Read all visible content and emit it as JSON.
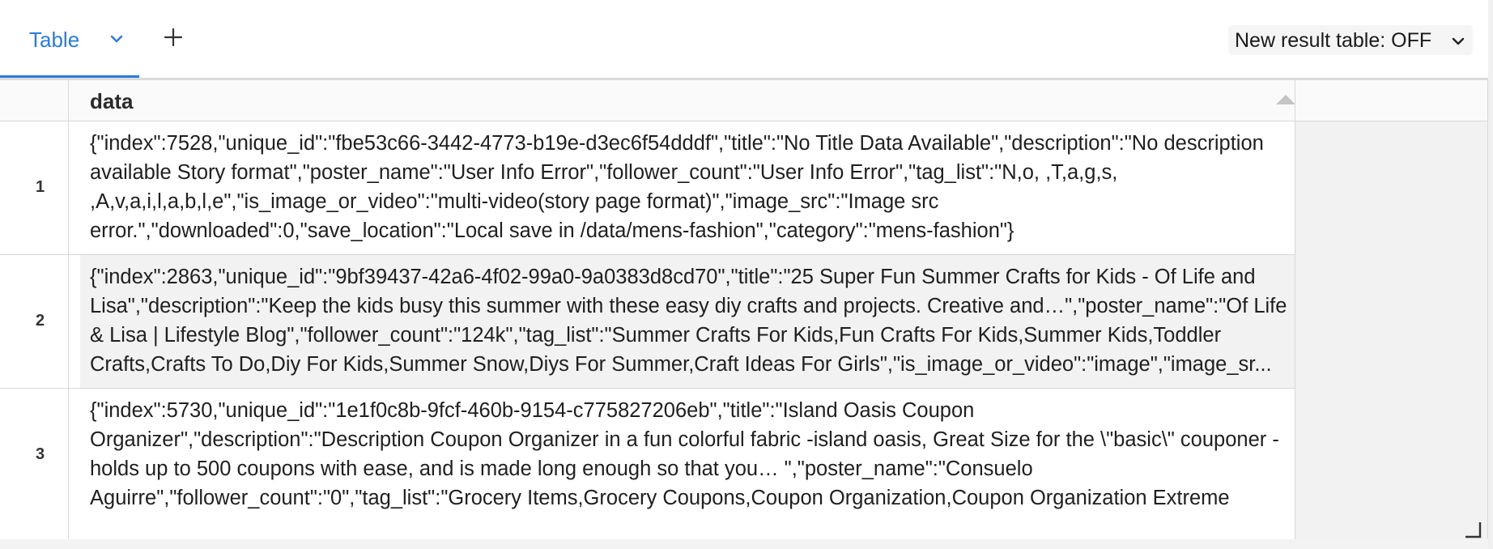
{
  "tabs": {
    "active_label": "Table",
    "add_icon": "plus-icon",
    "chevron_icon": "chevron-down-icon"
  },
  "toolbar": {
    "new_result_label": "New result table: OFF"
  },
  "table": {
    "column_header": "data",
    "sort": "ascending",
    "rows": [
      {
        "num": "1",
        "data": "{\"index\":7528,\"unique_id\":\"fbe53c66-3442-4773-b19e-d3ec6f54dddf\",\"title\":\"No Title Data Available\",\"description\":\"No description available Story format\",\"poster_name\":\"User Info Error\",\"follower_count\":\"User Info Error\",\"tag_list\":\"N,o, ,T,a,g,s, ,A,v,a,i,l,a,b,l,e\",\"is_image_or_video\":\"multi-video(story page format)\",\"image_src\":\"Image src error.\",\"downloaded\":0,\"save_location\":\"Local save in /data/mens-fashion\",\"category\":\"mens-fashion\"}"
      },
      {
        "num": "2",
        "data": "{\"index\":2863,\"unique_id\":\"9bf39437-42a6-4f02-99a0-9a0383d8cd70\",\"title\":\"25 Super Fun Summer Crafts for Kids - Of Life and Lisa\",\"description\":\"Keep the kids busy this summer with these easy diy crafts and projects. Creative and…\",\"poster_name\":\"Of Life & Lisa | Lifestyle Blog\",\"follower_count\":\"124k\",\"tag_list\":\"Summer Crafts For Kids,Fun Crafts For Kids,Summer Kids,Toddler Crafts,Crafts To Do,Diy For Kids,Summer Snow,Diys For Summer,Craft Ideas For Girls\",\"is_image_or_video\":\"image\",\"image_sr..."
      },
      {
        "num": "3",
        "data": "{\"index\":5730,\"unique_id\":\"1e1f0c8b-9fcf-460b-9154-c775827206eb\",\"title\":\"Island Oasis Coupon Organizer\",\"description\":\"Description Coupon Organizer in a fun colorful fabric -island oasis, Great Size for the \\\"basic\\\" couponer - holds up to 500 coupons with ease, and is made long enough so that you… \",\"poster_name\":\"Consuelo Aguirre\",\"follower_count\":\"0\",\"tag_list\":\"Grocery Items,Grocery Coupons,Coupon Organization,Coupon Organization Extreme"
      }
    ]
  },
  "colors": {
    "accent": "#2b7bd8",
    "row_alt": "#f2f2f2",
    "border": "#d8d8d8"
  }
}
